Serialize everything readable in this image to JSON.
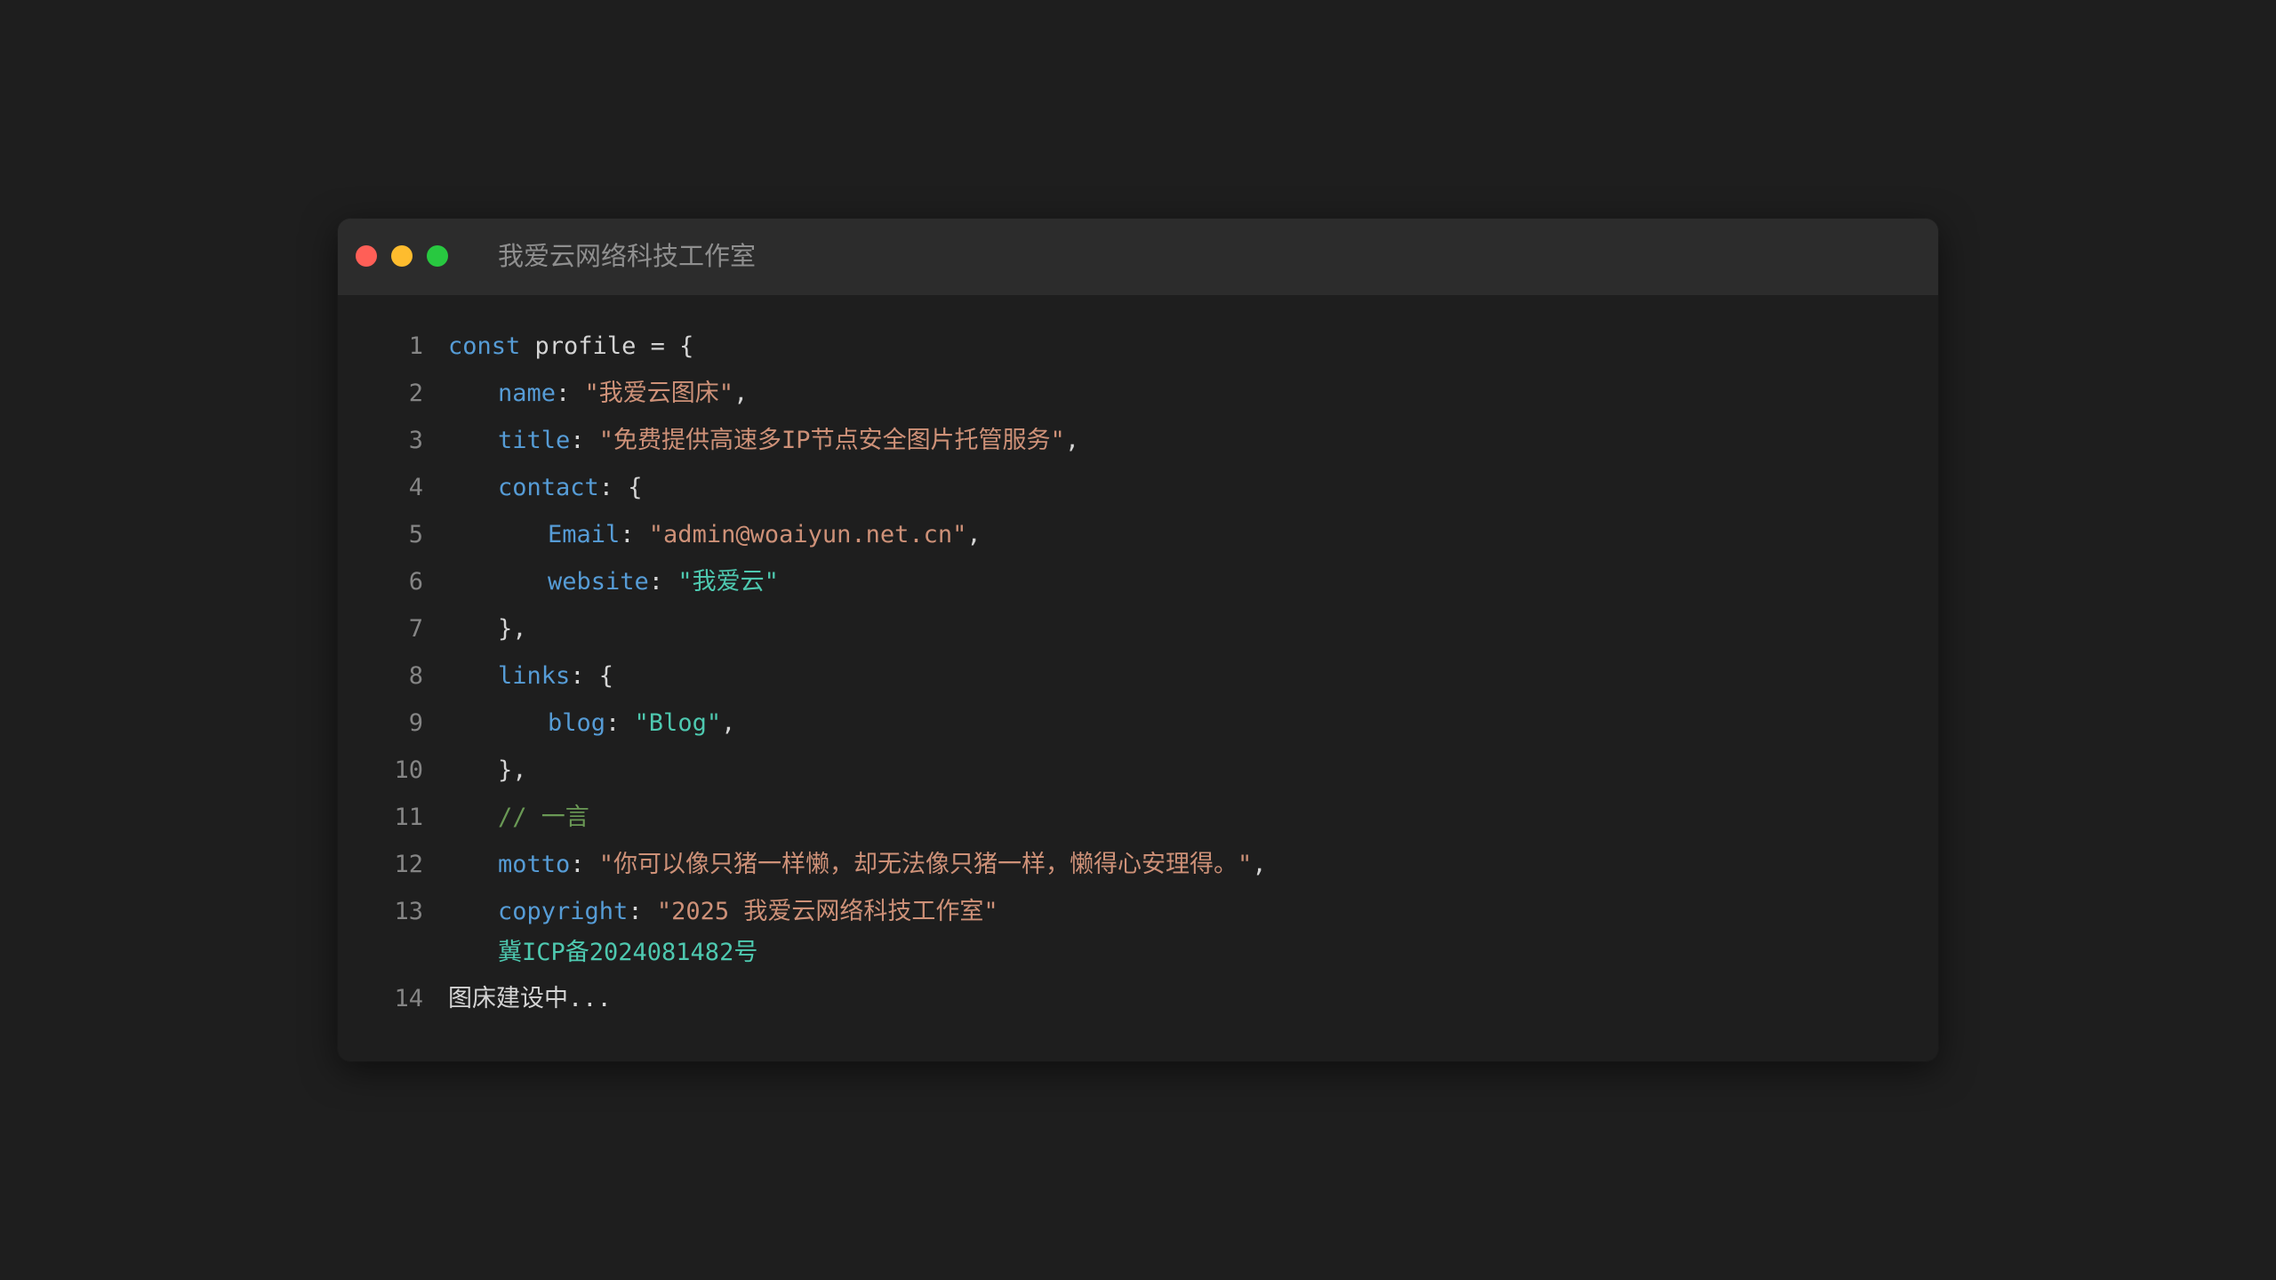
{
  "window": {
    "title": "我爱云网络科技工作室",
    "colors": {
      "close": "#ff5f57",
      "minimize": "#febc2e",
      "maximize": "#28c840"
    }
  },
  "code": {
    "lines": [
      {
        "num": "1",
        "parts": [
          "const",
          " profile = {"
        ]
      },
      {
        "num": "2",
        "parts": [
          "name",
          ": ",
          "\"我爱云图床\"",
          ","
        ]
      },
      {
        "num": "3",
        "parts": [
          "title",
          ": ",
          "\"免费提供高速多IP节点安全图片托管服务\"",
          ","
        ]
      },
      {
        "num": "4",
        "parts": [
          "contact",
          ": {"
        ]
      },
      {
        "num": "5",
        "parts": [
          "Email",
          ": ",
          "\"admin@woaiyun.net.cn\"",
          ","
        ]
      },
      {
        "num": "6",
        "parts": [
          "website",
          ": ",
          "\"我爱云\""
        ]
      },
      {
        "num": "7",
        "parts": [
          "},"
        ]
      },
      {
        "num": "8",
        "parts": [
          "links",
          ": {"
        ]
      },
      {
        "num": "9",
        "parts": [
          "blog",
          ": ",
          "\"Blog\"",
          ","
        ]
      },
      {
        "num": "10",
        "parts": [
          "},"
        ]
      },
      {
        "num": "11",
        "parts": [
          "// 一言"
        ]
      },
      {
        "num": "12",
        "parts": [
          "motto",
          ": ",
          "\"你可以像只猪一样懒，却无法像只猪一样，懒得心安理得。\"",
          ","
        ]
      },
      {
        "num": "13",
        "parts": [
          "copyright",
          ": ",
          "\"2025 我爱云网络科技工作室\"",
          "冀ICP备2024081482号"
        ]
      },
      {
        "num": "14",
        "parts": [
          "图床建设中..."
        ]
      }
    ]
  }
}
